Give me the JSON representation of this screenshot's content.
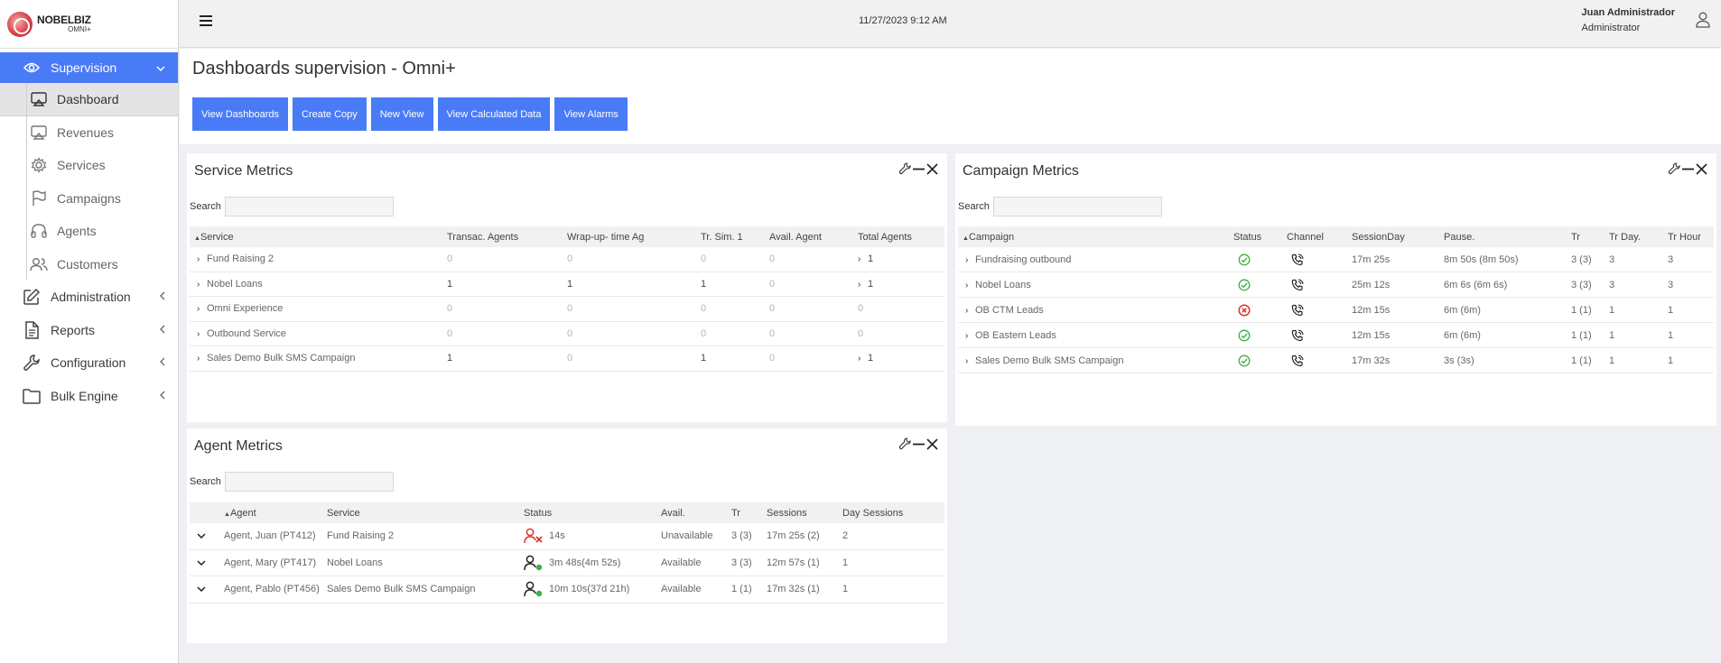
{
  "logo": {
    "brand": "NOBELBIZ",
    "product": "OMNI+"
  },
  "sidebar": {
    "items": [
      {
        "label": "Supervision",
        "icon": "eye-icon"
      },
      {
        "label": "Administration",
        "icon": "edit-icon"
      },
      {
        "label": "Reports",
        "icon": "document-icon"
      },
      {
        "label": "Configuration",
        "icon": "wrench-icon"
      },
      {
        "label": "Bulk Engine",
        "icon": "folder-icon"
      }
    ],
    "sub_items": [
      {
        "label": "Dashboard",
        "icon": "monitor-icon"
      },
      {
        "label": "Revenues",
        "icon": "monitor-icon"
      },
      {
        "label": "Services",
        "icon": "gear-icon"
      },
      {
        "label": "Campaigns",
        "icon": "flag-icon"
      },
      {
        "label": "Agents",
        "icon": "headset-icon"
      },
      {
        "label": "Customers",
        "icon": "users-icon"
      }
    ]
  },
  "header": {
    "datetime": "11/27/2023 9:12 AM",
    "user_name": "Juan Administrador",
    "user_role": "Administrator"
  },
  "page": {
    "title": "Dashboards supervision - Omni+",
    "buttons": [
      "View Dashboards",
      "Create Copy",
      "New View",
      "View Calculated Data",
      "View Alarms"
    ]
  },
  "service_metrics": {
    "title": "Service Metrics",
    "search_label": "Search",
    "columns": [
      "Service",
      "Transac. Agents",
      "Wrap-up- time Ag",
      "Tr. Sim. 1",
      "Avail. Agent",
      "Total Agents"
    ],
    "rows": [
      [
        "Fund Raising 2",
        "0",
        "0",
        "0",
        "0",
        "1"
      ],
      [
        "Nobel Loans",
        "1",
        "1",
        "1",
        "0",
        "1"
      ],
      [
        "Omni Experience",
        "0",
        "0",
        "0",
        "0",
        "0"
      ],
      [
        "Outbound Service",
        "0",
        "0",
        "0",
        "0",
        "0"
      ],
      [
        "Sales Demo Bulk SMS Campaign",
        "1",
        "0",
        "1",
        "0",
        "1"
      ]
    ]
  },
  "campaign_metrics": {
    "title": "Campaign Metrics",
    "search_label": "Search",
    "columns": [
      "Campaign",
      "Status",
      "Channel",
      "SessionDay",
      "Pause.",
      "Tr",
      "Tr Day.",
      "Tr Hour"
    ],
    "rows": [
      {
        "name": "Fundraising outbound",
        "status": "ok",
        "session": "17m 25s",
        "pause": "8m 50s (8m 50s)",
        "tr": "3 (3)",
        "trday": "3",
        "trhour": "3"
      },
      {
        "name": "Nobel Loans",
        "status": "ok",
        "session": "25m 12s",
        "pause": "6m 6s (6m 6s)",
        "tr": "3 (3)",
        "trday": "3",
        "trhour": "3"
      },
      {
        "name": "OB CTM Leads",
        "status": "error",
        "session": "12m 15s",
        "pause": "6m (6m)",
        "tr": "1 (1)",
        "trday": "1",
        "trhour": "1"
      },
      {
        "name": "OB Eastern Leads",
        "status": "ok",
        "session": "12m 15s",
        "pause": "6m (6m)",
        "tr": "1 (1)",
        "trday": "1",
        "trhour": "1"
      },
      {
        "name": "Sales Demo Bulk SMS Campaign",
        "status": "ok",
        "session": "17m 32s",
        "pause": "3s (3s)",
        "tr": "1 (1)",
        "trday": "1",
        "trhour": "1"
      }
    ]
  },
  "agent_metrics": {
    "title": "Agent Metrics",
    "search_label": "Search",
    "columns": [
      "Agent",
      "Service",
      "Status",
      "Avail.",
      "Tr",
      "Sessions",
      "Day Sessions"
    ],
    "rows": [
      {
        "agent": "Agent, Juan (PT412)",
        "service": "Fund Raising 2",
        "state": "unavailable",
        "status": "14s",
        "avail": "Unavailable",
        "tr": "3 (3)",
        "sessions": "17m 25s (2)",
        "day": "2"
      },
      {
        "agent": "Agent, Mary (PT417)",
        "service": "Nobel Loans",
        "state": "available",
        "status": "3m 48s(4m 52s)",
        "avail": "Available",
        "tr": "3 (3)",
        "sessions": "12m 57s (1)",
        "day": "1"
      },
      {
        "agent": "Agent, Pablo (PT456)",
        "service": "Sales Demo Bulk SMS Campaign",
        "state": "available",
        "status": "10m 10s(37d 21h)",
        "avail": "Available",
        "tr": "1 (1)",
        "sessions": "17m 32s (1)",
        "day": "1"
      }
    ]
  },
  "colors": {
    "accent": "#4a7bf7",
    "ok": "#3cb043",
    "error": "#d9342b"
  }
}
